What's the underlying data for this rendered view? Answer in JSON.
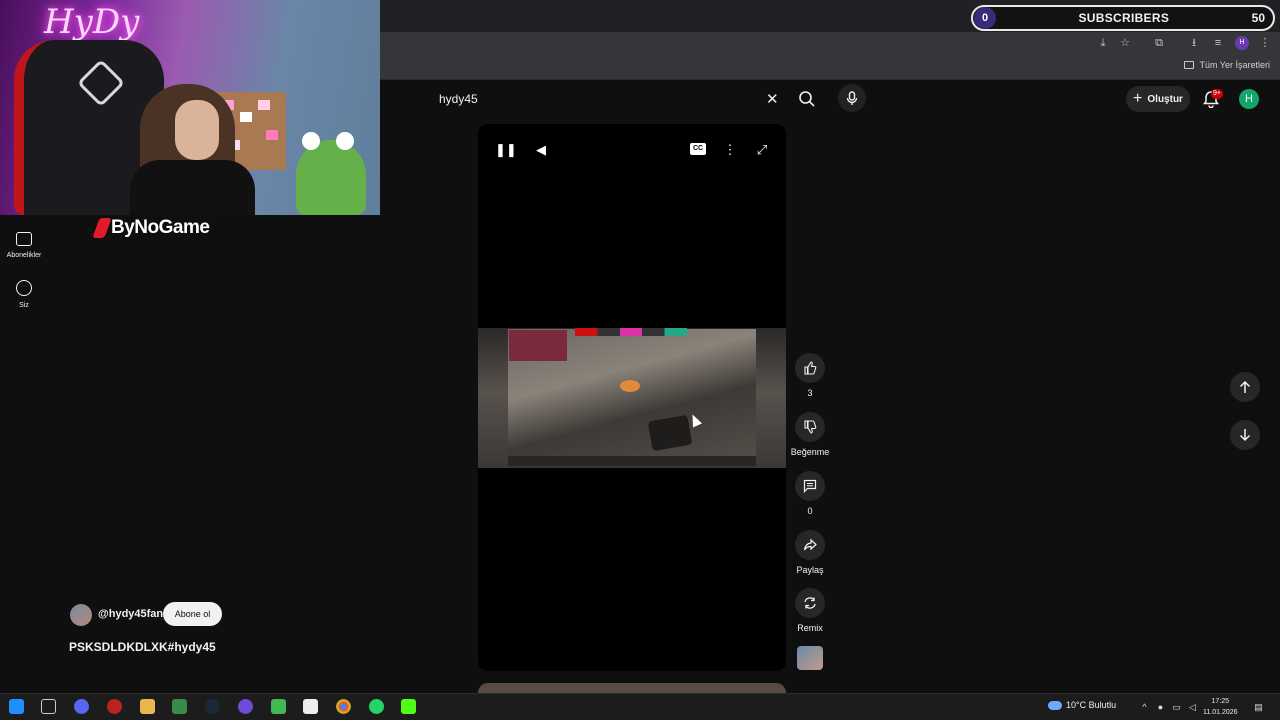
{
  "overlay": {
    "subscribers_label": "SUBSCRIBERS",
    "left_count": "0",
    "right_count": "50"
  },
  "webcam": {
    "neon_sign": "HyDy",
    "sponsor": "ByNoGame"
  },
  "browser": {
    "bookmarks_all": "Tüm Yer İşaretleri"
  },
  "left_nav": {
    "items": [
      {
        "label": "Abonelikler",
        "icon": "subscriptions-icon"
      },
      {
        "label": "Siz",
        "icon": "user-icon"
      }
    ]
  },
  "header": {
    "search_value": "hydy45",
    "create_label": "Oluştur",
    "notif_badge": "9+",
    "avatar_letter": "H"
  },
  "video": {
    "cc_label": "CC"
  },
  "actions": {
    "like_count": "3",
    "dislike_label": "Beğenme",
    "comments_count": "0",
    "share_label": "Paylaş",
    "remix_label": "Remix"
  },
  "channel": {
    "handle": "@hydy45fan",
    "subscribe_label": "Abone ol",
    "video_title": "PSKSDLDKDLXK#hydy45"
  },
  "taskbar": {
    "weather": "10°C  Bulutlu",
    "time": "17:25",
    "date": "11.01.2026"
  },
  "colors": {
    "yt_background": "#0f0f0f",
    "button_bg": "#272727",
    "notif_red": "#cc0000",
    "avatar_green": "#11a66a"
  }
}
